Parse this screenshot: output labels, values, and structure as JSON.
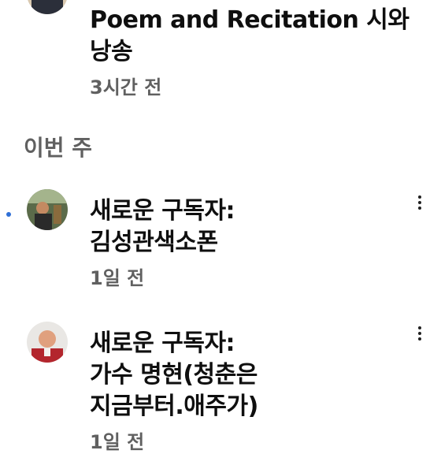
{
  "notifications_top": {
    "title_line1": "Poem and Recitation 시와",
    "title_line2": "낭송",
    "time": "3시간 전"
  },
  "section_header": "이번 주",
  "notifications": [
    {
      "line1": "새로운 구독자:",
      "line2": "김성관색소폰",
      "time": "1일 전",
      "unread": true
    },
    {
      "line1": "새로운 구독자:",
      "line2": "가수 명현(청춘은",
      "line3": "지금부터.애주가)",
      "time": "1일 전",
      "unread": false
    }
  ],
  "icons": {
    "unread": "unread-dot-icon",
    "more": "more-vert-icon"
  },
  "colors": {
    "unread_dot": "#2f6fd6",
    "secondary_text": "#606060"
  }
}
